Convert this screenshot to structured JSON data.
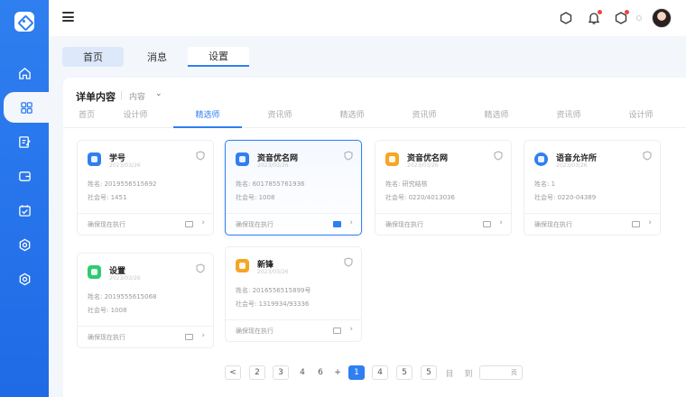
{
  "colors": {
    "primary": "#2f7ff0",
    "sidebar": "#1f6ae6",
    "danger": "#f04141"
  },
  "sidebar": {
    "items": [
      {
        "icon": "home-icon"
      },
      {
        "icon": "grid-icon"
      },
      {
        "icon": "edit-document-icon"
      },
      {
        "icon": "wallet-icon"
      },
      {
        "icon": "calendar-icon"
      },
      {
        "icon": "settings-hex-icon"
      },
      {
        "icon": "settings-hex-alt-icon"
      }
    ]
  },
  "topbar": {
    "icons": [
      "home-outline-icon",
      "bell-icon",
      "notification-icon",
      "dot-icon",
      "user-avatar"
    ]
  },
  "tabs": [
    "首页",
    "消息",
    "设置"
  ],
  "panel": {
    "title": "详单内容",
    "select_placeholder": "内容",
    "subtabs": [
      "首页",
      "设计师",
      "精选师",
      "资讯师",
      "精选师",
      "资讯师",
      "精选师",
      "资讯师",
      "设计师"
    ]
  },
  "cards": [
    {
      "title": "学号",
      "sub": "2023/03/26",
      "line1": "姓名: 2019556515692",
      "line2": "社会号: 1451",
      "foot": "确保现在执行",
      "icon_color": "#2f7ff0"
    },
    {
      "title": "资音优名网",
      "sub": "2023/03/26",
      "line1": "姓名: 6017855761936",
      "line2": "社会号: 1008",
      "foot": "确保现在执行",
      "icon_color": "#2f7ff0"
    },
    {
      "title": "资音优名网",
      "sub": "2023/03/26",
      "line1": "姓名: 研究结核",
      "line2": "社会号: 0220/4013036",
      "foot": "确保现在执行",
      "icon_color": "#f5a623"
    },
    {
      "title": "语音允许所",
      "sub": "2023/03/26",
      "line1": "姓名: 1",
      "line2": "社会号: 0220-04389",
      "foot": "确保现在执行",
      "icon_color": "#2f7ff0"
    },
    {
      "title": "设置",
      "sub": "2023/03/26",
      "line1": "姓名: 2019555615068",
      "line2": "社会号: 1008",
      "foot": "确保现在执行",
      "icon_color": "#2ecc71"
    },
    {
      "title": "新锋",
      "sub": "2023/03/26",
      "line1": "姓名: 2016556515899号",
      "line2": "社会号: 1319934/93336",
      "foot": "确保现在执行",
      "icon_color": "#f5a623"
    }
  ],
  "pagination": {
    "prev": "<",
    "pages": [
      "2",
      "3",
      "4",
      "6",
      "+",
      "1",
      "4",
      "5",
      "5",
      "目",
      "到"
    ],
    "jump_suffix": "页"
  }
}
